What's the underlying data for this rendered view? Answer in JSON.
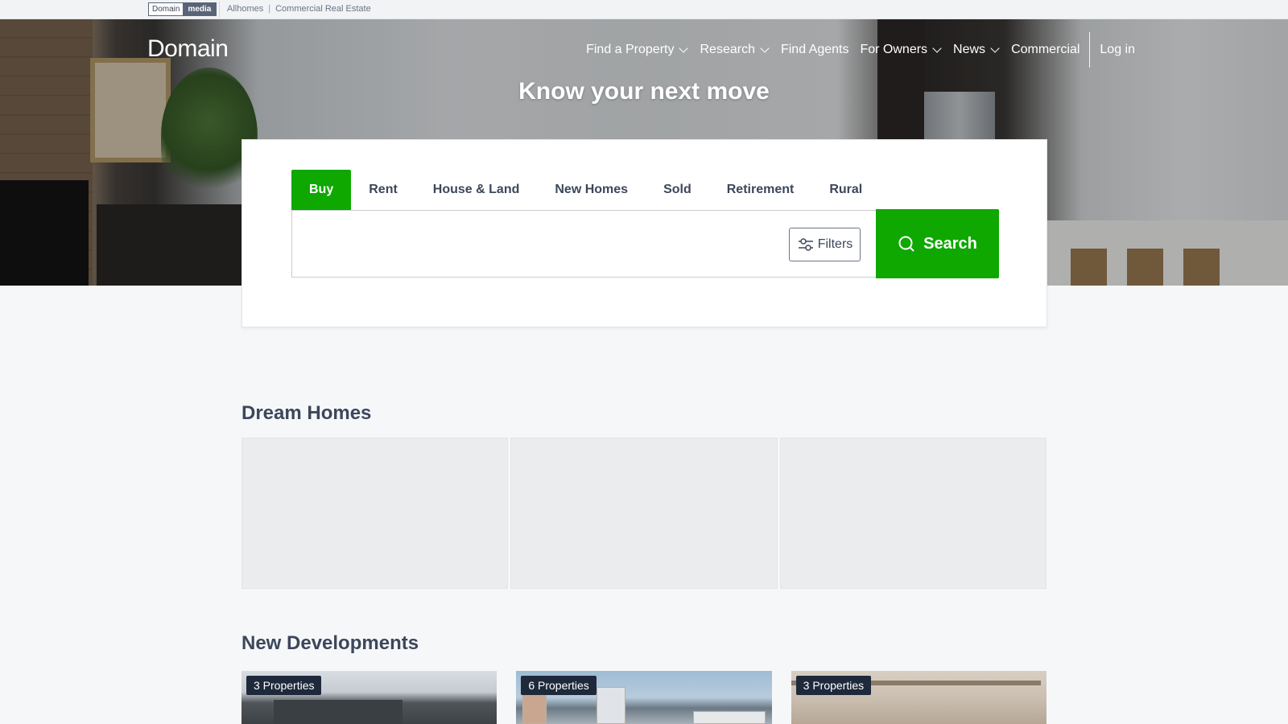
{
  "topbar": {
    "brand_left": "Domain",
    "brand_right": "media",
    "links": [
      "Allhomes",
      "Commercial Real Estate"
    ],
    "divider": "|"
  },
  "header": {
    "logo": "Domain",
    "nav": [
      {
        "label": "Find a Property",
        "dropdown": true
      },
      {
        "label": "Research",
        "dropdown": true
      },
      {
        "label": "Find Agents",
        "dropdown": false
      },
      {
        "label": "For Owners",
        "dropdown": true
      },
      {
        "label": "News",
        "dropdown": true
      },
      {
        "label": "Commercial",
        "dropdown": false
      }
    ],
    "login": "Log in"
  },
  "hero": {
    "title": "Know your next move"
  },
  "search": {
    "tabs": [
      "Buy",
      "Rent",
      "House & Land",
      "New Homes",
      "Sold",
      "Retirement",
      "Rural"
    ],
    "active_tab": "Buy",
    "input_value": "",
    "filters_label": "Filters",
    "search_label": "Search",
    "accent_color": "#0ea800"
  },
  "sections": {
    "dream_homes_title": "Dream Homes",
    "new_developments_title": "New Developments"
  },
  "developments": [
    {
      "badge": "3 Properties"
    },
    {
      "badge": "6 Properties"
    },
    {
      "badge": "3 Properties"
    }
  ]
}
